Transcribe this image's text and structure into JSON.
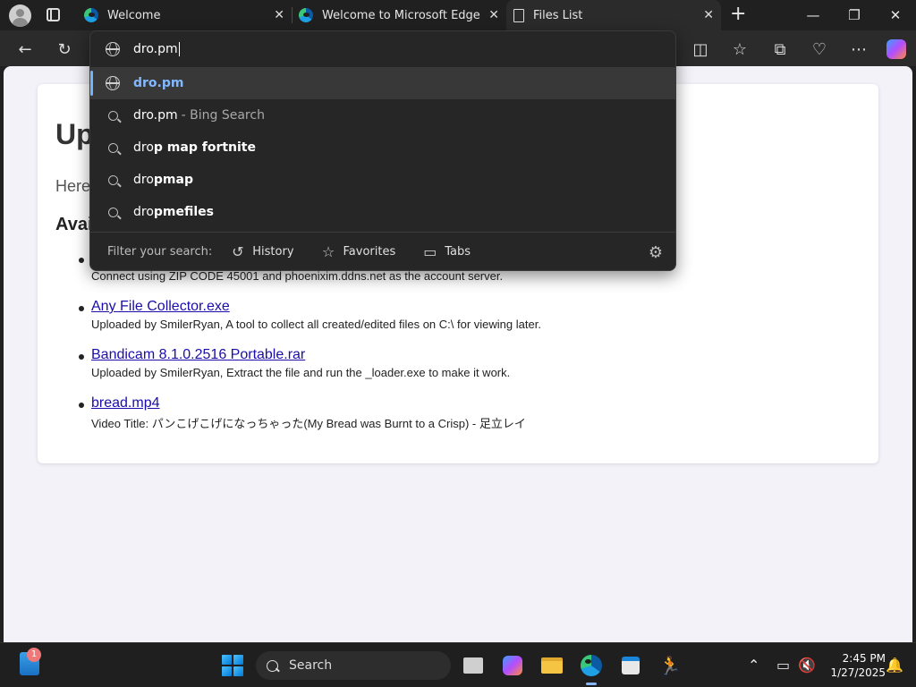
{
  "tabs": [
    {
      "title": "Welcome",
      "icon": "edge-icon"
    },
    {
      "title": "Welcome to Microsoft Edge",
      "icon": "edge-icon"
    },
    {
      "title": "Files List",
      "icon": "document-icon",
      "active": true
    }
  ],
  "omnibox": {
    "typed": "dro.pm",
    "suggestions": [
      {
        "prefix": "",
        "bold": "dro.pm",
        "hint": "",
        "type": "url"
      },
      {
        "prefix": "dro.pm",
        "bold": "",
        "hint": "- Bing Search",
        "type": "search"
      },
      {
        "prefix": "dro",
        "bold": "p map fortnite",
        "hint": "",
        "type": "search"
      },
      {
        "prefix": "dro",
        "bold": "pmap",
        "hint": "",
        "type": "search"
      },
      {
        "prefix": "dro",
        "bold": "pmefiles",
        "hint": "",
        "type": "search"
      }
    ],
    "filter_label": "Filter your search:",
    "filters": [
      "History",
      "Favorites",
      "Tabs"
    ]
  },
  "page": {
    "heading": "Up",
    "intro": "Here",
    "subheading": "Avai",
    "files": [
      {
        "name": "",
        "desc": "Connect using ZIP CODE 45001 and phoenixim.ddns.net as the account server."
      },
      {
        "name": "Any File Collector.exe",
        "desc": "Uploaded by SmilerRyan, A tool to collect all created/edited files on C:\\ for viewing later."
      },
      {
        "name": "Bandicam 8.1.0.2516 Portable.rar",
        "desc": "Uploaded by SmilerRyan, Extract the file and run the _loader.exe to make it work."
      },
      {
        "name": "bread.mp4",
        "desc": "Video Title: パンこげこげになっちゃった(My Bread was Burnt to a Crisp) - 足立レイ"
      }
    ]
  },
  "taskbar": {
    "search_placeholder": "Search",
    "notification_count": "1",
    "time": "2:45 PM",
    "date": "1/27/2025"
  },
  "colors": {
    "accent": "#70b4ff",
    "link": "#1a0dab",
    "page_bg": "#f3f2f8"
  }
}
